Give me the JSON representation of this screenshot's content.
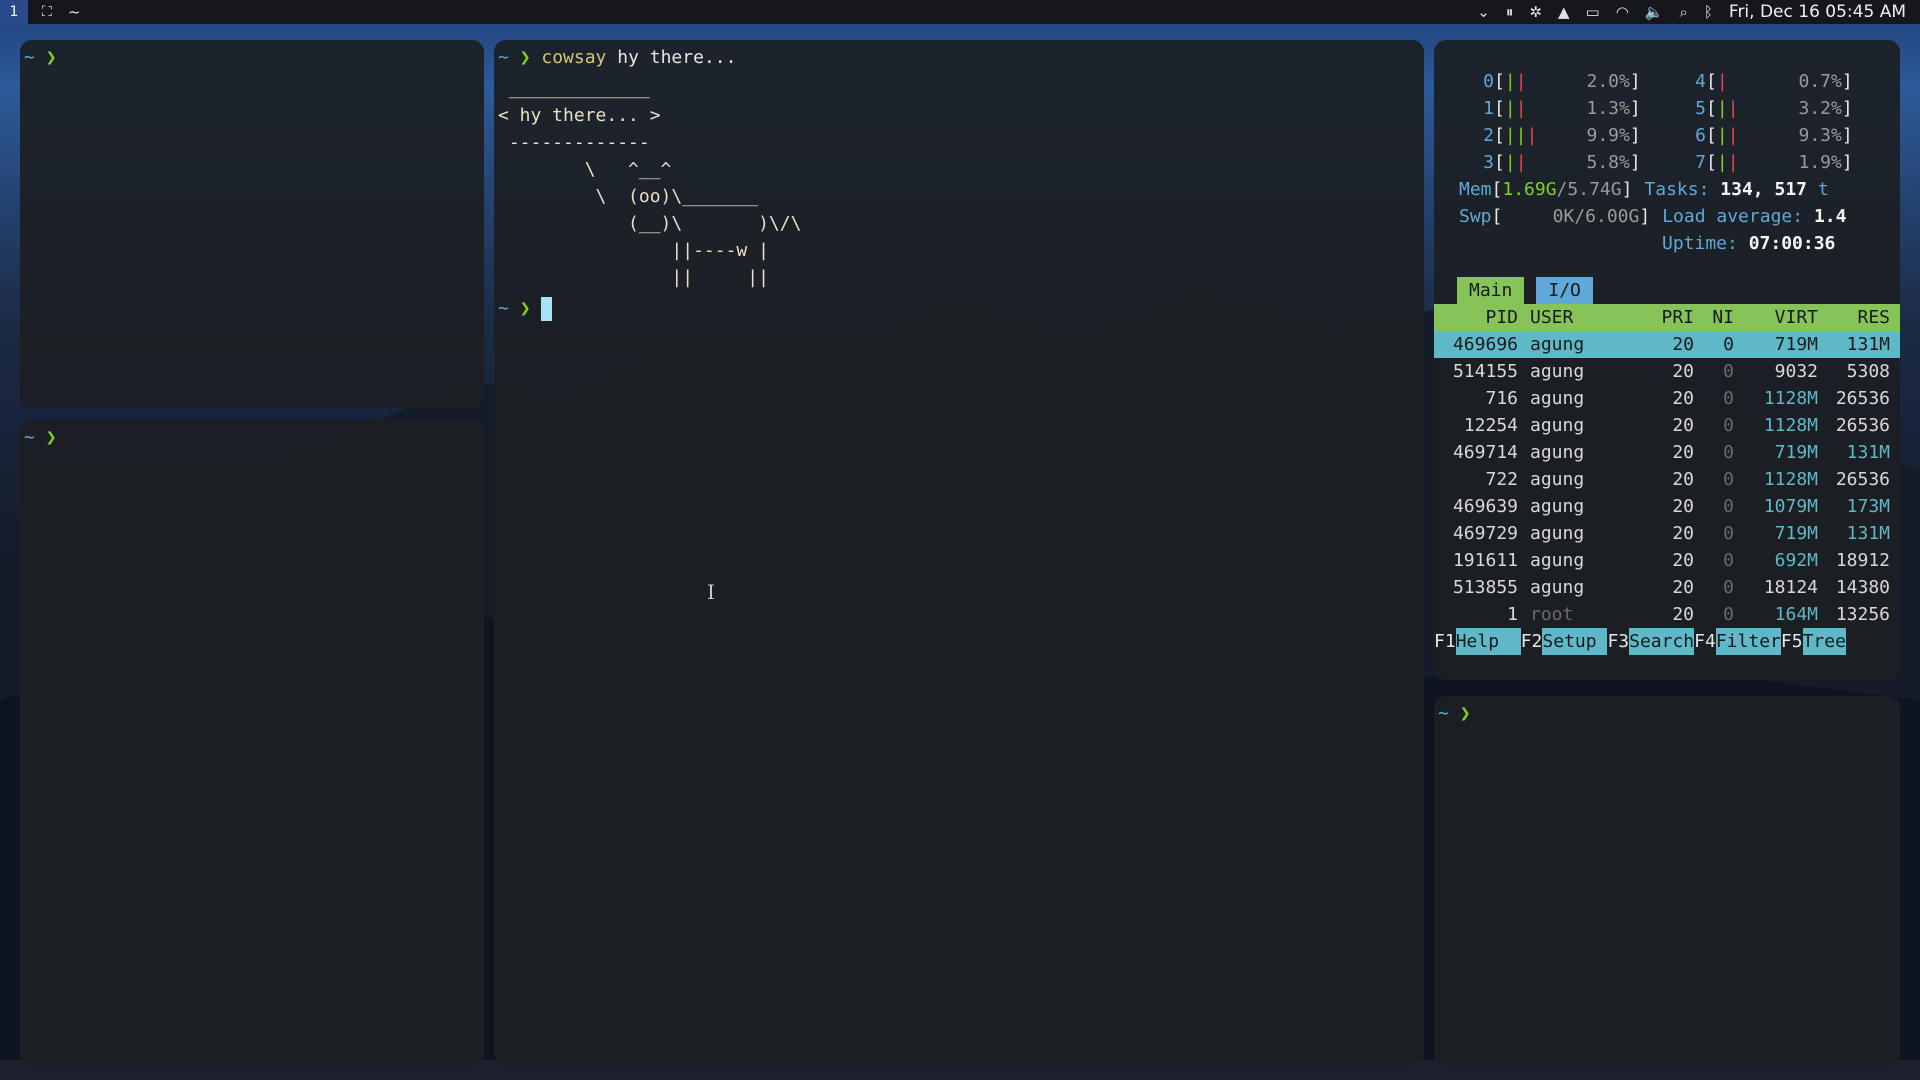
{
  "topbar": {
    "workspace": "1",
    "title": "~",
    "clock": "Fri, Dec 16  05:45 AM",
    "icons": [
      "chevron-down-icon",
      "pause-icon",
      "settings-icon",
      "drive-icon",
      "battery-icon",
      "wifi-icon",
      "volume-icon",
      "search-icon",
      "bluetooth-icon"
    ]
  },
  "prompt": {
    "tilde": "~",
    "arrow": "❯"
  },
  "center": {
    "command": "cowsay",
    "args": "hy there...",
    "cow": " _____________\n< hy there... >\n -------------\n        \\   ^__^\n         \\  (oo)\\_______\n            (__)\\       )\\/\\\n                ||----w |\n                ||     ||"
  },
  "htop": {
    "cpus": [
      {
        "n": "0",
        "g": "|",
        "r": "|",
        "pct": "2.0%"
      },
      {
        "n": "4",
        "g": "",
        "r": "|",
        "pct": "0.7%"
      },
      {
        "n": "1",
        "g": "|",
        "r": "|",
        "pct": "1.3%"
      },
      {
        "n": "5",
        "g": "|",
        "r": "|",
        "pct": "3.2%"
      },
      {
        "n": "2",
        "g": "||",
        "r": "|",
        "pct": "9.9%"
      },
      {
        "n": "6",
        "g": "|",
        "r": "|",
        "pct": "9.3%"
      },
      {
        "n": "3",
        "g": "|",
        "r": "|",
        "pct": "5.8%"
      },
      {
        "n": "7",
        "g": "|",
        "r": "|",
        "pct": "1.9%"
      }
    ],
    "mem": {
      "label": "Mem",
      "used": "1.69G",
      "total": "5.74G"
    },
    "swp": {
      "label": "Swp",
      "value": "0K/6.00G"
    },
    "tasks": {
      "label": "Tasks:",
      "procs": "134,",
      "threads": "517",
      "suffix": "t"
    },
    "load": {
      "label": "Load average:",
      "value": "1.4"
    },
    "uptime": {
      "label": "Uptime:",
      "value": "07:00:36"
    },
    "tabs": [
      "Main",
      "I/O"
    ],
    "columns": [
      "PID",
      "USER",
      "PRI",
      "NI",
      "VIRT",
      "RES"
    ],
    "rows": [
      {
        "pid": "469696",
        "user": "agung",
        "pri": "20",
        "ni": "0",
        "virt": "719M",
        "res": "131M"
      },
      {
        "pid": "514155",
        "user": "agung",
        "pri": "20",
        "ni": "0",
        "virt": "9032",
        "res": "5308"
      },
      {
        "pid": "716",
        "user": "agung",
        "pri": "20",
        "ni": "0",
        "virt": "1128M",
        "res": "26536"
      },
      {
        "pid": "12254",
        "user": "agung",
        "pri": "20",
        "ni": "0",
        "virt": "1128M",
        "res": "26536"
      },
      {
        "pid": "469714",
        "user": "agung",
        "pri": "20",
        "ni": "0",
        "virt": "719M",
        "res": "131M"
      },
      {
        "pid": "722",
        "user": "agung",
        "pri": "20",
        "ni": "0",
        "virt": "1128M",
        "res": "26536"
      },
      {
        "pid": "469639",
        "user": "agung",
        "pri": "20",
        "ni": "0",
        "virt": "1079M",
        "res": "173M"
      },
      {
        "pid": "469729",
        "user": "agung",
        "pri": "20",
        "ni": "0",
        "virt": "719M",
        "res": "131M"
      },
      {
        "pid": "191611",
        "user": "agung",
        "pri": "20",
        "ni": "0",
        "virt": "692M",
        "res": "18912"
      },
      {
        "pid": "513855",
        "user": "agung",
        "pri": "20",
        "ni": "0",
        "virt": "18124",
        "res": "14380"
      },
      {
        "pid": "1",
        "user": "root",
        "pri": "20",
        "ni": "0",
        "virt": "164M",
        "res": "13256"
      }
    ],
    "fkeys": [
      {
        "k": "F1",
        "l": "Help  "
      },
      {
        "k": "F2",
        "l": "Setup "
      },
      {
        "k": "F3",
        "l": "Search"
      },
      {
        "k": "F4",
        "l": "Filter"
      },
      {
        "k": "F5",
        "l": "Tree"
      }
    ]
  }
}
